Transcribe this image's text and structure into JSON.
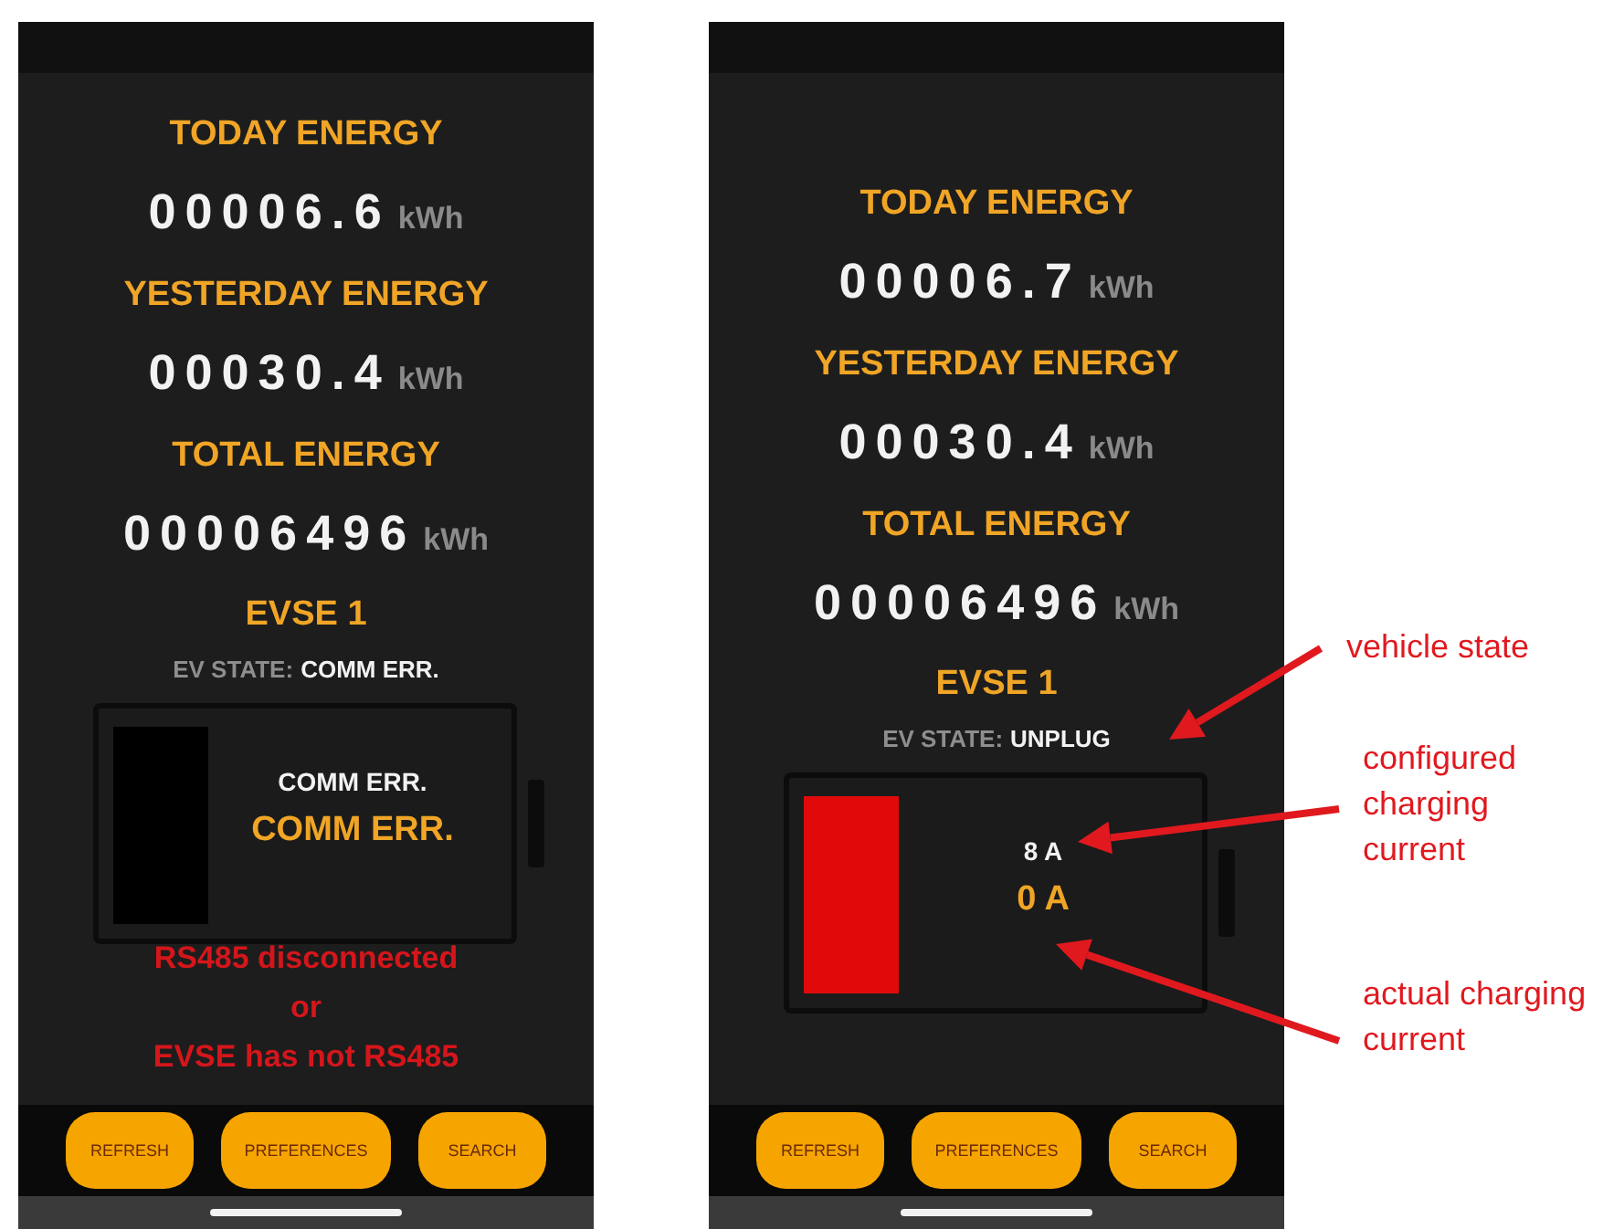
{
  "phones": [
    {
      "energy": [
        {
          "label": "TODAY ENERGY",
          "value": "00006.6",
          "unit": "kWh"
        },
        {
          "label": "YESTERDAY ENERGY",
          "value": "00030.4",
          "unit": "kWh"
        },
        {
          "label": "TOTAL ENERGY",
          "value": "00006496",
          "unit": "kWh"
        }
      ],
      "evse_title": "EVSE 1",
      "ev_state_label": "EV STATE:",
      "ev_state": "COMM ERR.",
      "charger": {
        "color": "#000000",
        "configured_current": "COMM ERR.",
        "actual_current": "COMM ERR."
      },
      "messages": [
        "RS485 disconnected",
        "or",
        "EVSE has not RS485"
      ],
      "buttons": [
        "REFRESH",
        "PREFERENCES",
        "SEARCH"
      ]
    },
    {
      "energy": [
        {
          "label": "TODAY ENERGY",
          "value": "00006.7",
          "unit": "kWh"
        },
        {
          "label": "YESTERDAY ENERGY",
          "value": "00030.4",
          "unit": "kWh"
        },
        {
          "label": "TOTAL ENERGY",
          "value": "00006496",
          "unit": "kWh"
        }
      ],
      "evse_title": "EVSE 1",
      "ev_state_label": "EV STATE:",
      "ev_state": "UNPLUG",
      "charger": {
        "color": "#e00a0a",
        "configured_current": "8 A",
        "actual_current": "0 A"
      },
      "buttons": [
        "REFRESH",
        "PREFERENCES",
        "SEARCH"
      ]
    }
  ],
  "annotations": [
    {
      "text": "vehicle state"
    },
    {
      "text": "configured charging current"
    },
    {
      "text": "actual charging current"
    }
  ]
}
